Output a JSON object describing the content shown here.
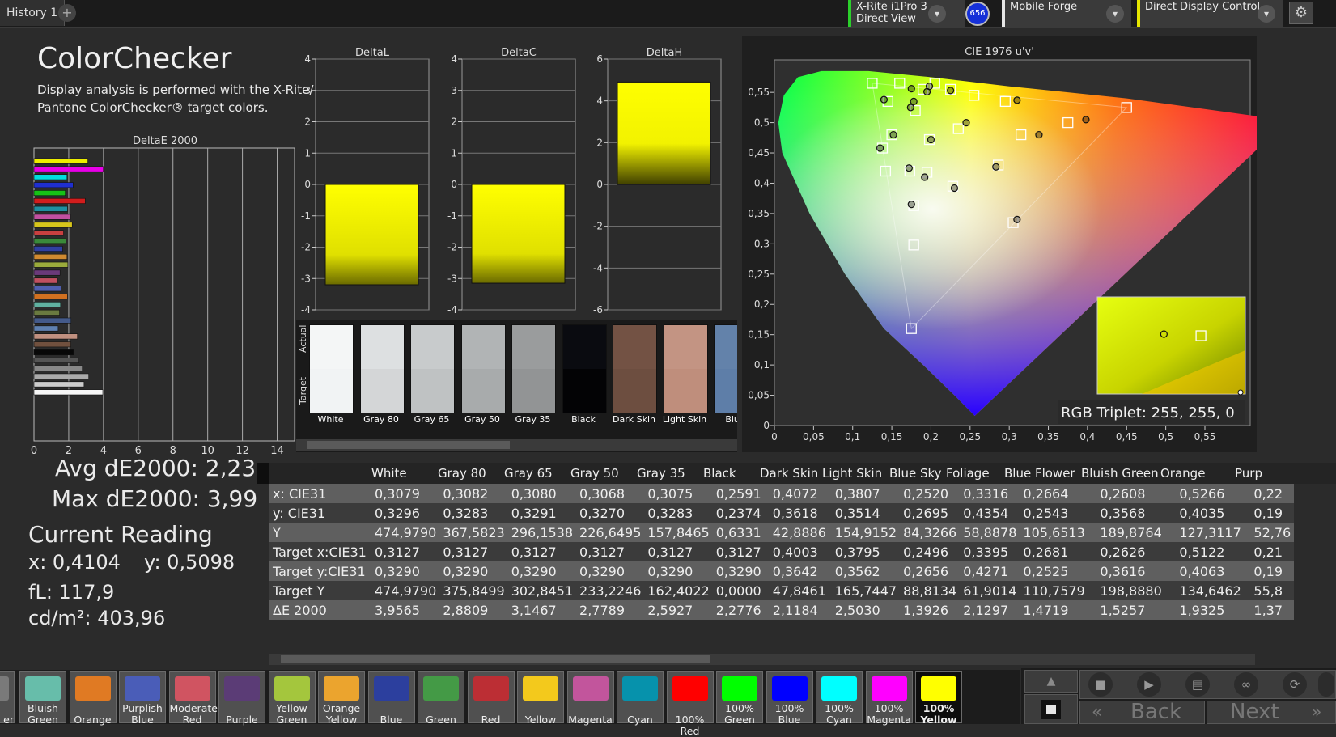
{
  "topbar": {
    "tab": "History 1",
    "add_tab": "+",
    "device": {
      "line1": "X-Rite i1Pro 3",
      "line2": "Direct View"
    },
    "device_badge": "656",
    "profile": "Mobile Forge",
    "mode": "Direct Display Control",
    "settings_icon": "gear-icon"
  },
  "page": {
    "title": "ColorChecker",
    "desc1": "Display analysis is performed with the X-Rite/",
    "desc2": "Pantone ColorChecker® target colors."
  },
  "deltae_chart": {
    "title": "DeltaE 2000",
    "xticks": [
      "0",
      "2",
      "4",
      "6",
      "8",
      "10",
      "12",
      "14"
    ],
    "xlim": [
      0,
      15
    ],
    "bars": [
      {
        "color": "#eded00",
        "value": 3.1
      },
      {
        "color": "#e800e8",
        "value": 3.99
      },
      {
        "color": "#00dede",
        "value": 1.9
      },
      {
        "color": "#1f2fd0",
        "value": 2.25
      },
      {
        "color": "#16c216",
        "value": 1.8
      },
      {
        "color": "#d21d1d",
        "value": 2.95
      },
      {
        "color": "#1f8fa0",
        "value": 1.93
      },
      {
        "color": "#c050a0",
        "value": 2.1
      },
      {
        "color": "#d6c51c",
        "value": 2.2
      },
      {
        "color": "#c84040",
        "value": 1.7
      },
      {
        "color": "#3a8a3a",
        "value": 1.85
      },
      {
        "color": "#3040a0",
        "value": 1.65
      },
      {
        "color": "#d08a30",
        "value": 1.9
      },
      {
        "color": "#9aaa3c",
        "value": 1.95
      },
      {
        "color": "#6a3a7a",
        "value": 1.5
      },
      {
        "color": "#c05060",
        "value": 1.35
      },
      {
        "color": "#5060b0",
        "value": 1.55
      },
      {
        "color": "#d07020",
        "value": 1.93
      },
      {
        "color": "#60b0a0",
        "value": 1.53
      },
      {
        "color": "#6a7a40",
        "value": 1.47
      },
      {
        "color": "#445a8a",
        "value": 2.13
      },
      {
        "color": "#5f80b0",
        "value": 1.39
      },
      {
        "color": "#c09080",
        "value": 2.5
      },
      {
        "color": "#70503e",
        "value": 2.12
      },
      {
        "color": "#080808",
        "value": 2.28
      },
      {
        "color": "#555555",
        "value": 2.59
      },
      {
        "color": "#888888",
        "value": 2.78
      },
      {
        "color": "#aaaaaa",
        "value": 3.15
      },
      {
        "color": "#cccccc",
        "value": 2.88
      },
      {
        "color": "#f6f6f6",
        "value": 3.96
      }
    ]
  },
  "delta_charts": [
    {
      "title": "DeltaL",
      "ylim": [
        -4,
        4
      ],
      "yticks": [
        "4",
        "3",
        "2",
        "1",
        "0",
        "-1",
        "-2",
        "-3",
        "-4"
      ],
      "value": -3.2
    },
    {
      "title": "DeltaC",
      "ylim": [
        -4,
        4
      ],
      "yticks": [
        "4",
        "3",
        "2",
        "1",
        "0",
        "-1",
        "-2",
        "-3",
        "-4"
      ],
      "value": -3.15
    },
    {
      "title": "DeltaH",
      "ylim": [
        -6,
        6
      ],
      "yticks": [
        "6",
        "4",
        "2",
        "0",
        "-2",
        "-4",
        "-6"
      ],
      "value": 4.9
    }
  ],
  "patch_strip": {
    "actual_label": "Actual",
    "target_label": "Target",
    "patches": [
      {
        "label": "White",
        "actual": "#f4f6f6",
        "target": "#f1f3f4"
      },
      {
        "label": "Gray 80",
        "actual": "#dde0e1",
        "target": "#d4d6d7"
      },
      {
        "label": "Gray 65",
        "actual": "#c8cbcc",
        "target": "#bfc2c3"
      },
      {
        "label": "Gray 50",
        "actual": "#b1b4b5",
        "target": "#a8abac"
      },
      {
        "label": "Gray 35",
        "actual": "#9a9c9d",
        "target": "#929495"
      },
      {
        "label": "Black",
        "actual": "#0a0b10",
        "target": "#030305"
      },
      {
        "label": "Dark Skin",
        "actual": "#735244",
        "target": "#6d4e40"
      },
      {
        "label": "Light Skin",
        "actual": "#c39483",
        "target": "#bf8e7c"
      },
      {
        "label": "Blue",
        "actual": "#6382aa",
        "target": "#5e7ea8"
      }
    ]
  },
  "cie_chart": {
    "title": "CIE 1976 u'v'",
    "xticks": [
      "0",
      "0,05",
      "0,1",
      "0,15",
      "0,2",
      "0,25",
      "0,3",
      "0,35",
      "0,4",
      "0,45",
      "0,5",
      "0,55"
    ],
    "yticks": [
      "0",
      "0,05",
      "0,1",
      "0,15",
      "0,2",
      "0,25",
      "0,3",
      "0,35",
      "0,4",
      "0,45",
      "0,5",
      "0,55"
    ],
    "xlim": [
      0,
      0.6
    ],
    "ylim": [
      0,
      0.6
    ],
    "targets": [
      [
        0.125,
        0.565
      ],
      [
        0.145,
        0.535
      ],
      [
        0.16,
        0.565
      ],
      [
        0.18,
        0.52
      ],
      [
        0.19,
        0.555
      ],
      [
        0.205,
        0.565
      ],
      [
        0.225,
        0.555
      ],
      [
        0.255,
        0.545
      ],
      [
        0.295,
        0.535
      ],
      [
        0.235,
        0.49
      ],
      [
        0.315,
        0.48
      ],
      [
        0.375,
        0.5
      ],
      [
        0.45,
        0.525
      ],
      [
        0.15,
        0.48
      ],
      [
        0.198,
        0.472
      ],
      [
        0.138,
        0.458
      ],
      [
        0.142,
        0.42
      ],
      [
        0.173,
        0.42
      ],
      [
        0.195,
        0.418
      ],
      [
        0.228,
        0.395
      ],
      [
        0.286,
        0.43
      ],
      [
        0.305,
        0.335
      ],
      [
        0.178,
        0.363
      ],
      [
        0.178,
        0.298
      ],
      [
        0.175,
        0.16
      ]
    ],
    "measured": [
      [
        0.14,
        0.538
      ],
      [
        0.175,
        0.556
      ],
      [
        0.198,
        0.56
      ],
      [
        0.195,
        0.551
      ],
      [
        0.225,
        0.553
      ],
      [
        0.31,
        0.537
      ],
      [
        0.245,
        0.5
      ],
      [
        0.338,
        0.48
      ],
      [
        0.398,
        0.505
      ],
      [
        0.174,
        0.525
      ],
      [
        0.152,
        0.48
      ],
      [
        0.2,
        0.472
      ],
      [
        0.135,
        0.458
      ],
      [
        0.172,
        0.425
      ],
      [
        0.192,
        0.41
      ],
      [
        0.23,
        0.392
      ],
      [
        0.283,
        0.427
      ],
      [
        0.31,
        0.34
      ],
      [
        0.175,
        0.365
      ],
      [
        0.178,
        0.535
      ]
    ],
    "inset": {
      "target": [
        0.7,
        0.7
      ],
      "measured": [
        0.45,
        0.55
      ]
    },
    "rgb_triplet": "RGB Triplet: 255, 255, 0"
  },
  "stats": {
    "avg": "Avg dE2000: 2,23",
    "max": "Max dE2000: 3,99",
    "reading_title": "Current Reading",
    "x": "x: 0,4104",
    "y": "y: 0,5098",
    "fl": "fL: 117,9",
    "cdm2": "cd/m²: 403,96"
  },
  "table": {
    "columns": [
      "",
      "White",
      "Gray 80",
      "Gray 65",
      "Gray 50",
      "Gray 35",
      "Black",
      "Dark Skin",
      "Light Skin",
      "Blue Sky",
      "Foliage",
      "Blue Flower",
      "Bluish Green",
      "Orange",
      "Purp"
    ],
    "rows": [
      [
        "x: CIE31",
        "0,3079",
        "0,3082",
        "0,3080",
        "0,3068",
        "0,3075",
        "0,2591",
        "0,4072",
        "0,3807",
        "0,2520",
        "0,3316",
        "0,2664",
        "0,2608",
        "0,5266",
        "0,22"
      ],
      [
        "y: CIE31",
        "0,3296",
        "0,3283",
        "0,3291",
        "0,3270",
        "0,3283",
        "0,2374",
        "0,3618",
        "0,3514",
        "0,2695",
        "0,4354",
        "0,2543",
        "0,3568",
        "0,4035",
        "0,19"
      ],
      [
        "Y",
        "474,9790",
        "367,5823",
        "296,1538",
        "226,6495",
        "157,8465",
        "0,6331",
        "42,8886",
        "154,9152",
        "84,3266",
        "58,8878",
        "105,6513",
        "189,8764",
        "127,3117",
        "52,76"
      ],
      [
        "Target x:CIE31",
        "0,3127",
        "0,3127",
        "0,3127",
        "0,3127",
        "0,3127",
        "0,3127",
        "0,4003",
        "0,3795",
        "0,2496",
        "0,3395",
        "0,2681",
        "0,2626",
        "0,5122",
        "0,21"
      ],
      [
        "Target y:CIE31",
        "0,3290",
        "0,3290",
        "0,3290",
        "0,3290",
        "0,3290",
        "0,3290",
        "0,3642",
        "0,3562",
        "0,2656",
        "0,4271",
        "0,2525",
        "0,3616",
        "0,4063",
        "0,19"
      ],
      [
        "Target Y",
        "474,9790",
        "375,8499",
        "302,8451",
        "233,2246",
        "162,4022",
        "0,0000",
        "47,8461",
        "165,7447",
        "88,8134",
        "61,9014",
        "110,7579",
        "198,8880",
        "134,6462",
        "55,8"
      ],
      [
        "ΔE 2000",
        "3,9565",
        "2,8809",
        "3,1467",
        "2,7789",
        "2,5927",
        "2,2776",
        "2,1184",
        "2,5030",
        "1,3926",
        "2,1297",
        "1,4719",
        "1,5257",
        "1,9325",
        "1,37"
      ]
    ]
  },
  "swatches": [
    {
      "line1": "",
      "line2": "er",
      "color": ""
    },
    {
      "line1": "Bluish",
      "line2": "Green",
      "color": "#67bdaa"
    },
    {
      "line1": "",
      "line2": "Orange",
      "color": "#e07a23"
    },
    {
      "line1": "Purplish",
      "line2": "Blue",
      "color": "#4a5db8"
    },
    {
      "line1": "Moderate",
      "line2": "Red",
      "color": "#d05461"
    },
    {
      "line1": "",
      "line2": "Purple",
      "color": "#5b3c76"
    },
    {
      "line1": "Yellow",
      "line2": "Green",
      "color": "#a4c63d"
    },
    {
      "line1": "Orange",
      "line2": "Yellow",
      "color": "#eba42e"
    },
    {
      "line1": "",
      "line2": "Blue",
      "color": "#2c3f9e"
    },
    {
      "line1": "",
      "line2": "Green",
      "color": "#449a46"
    },
    {
      "line1": "",
      "line2": "Red",
      "color": "#bc2e34"
    },
    {
      "line1": "",
      "line2": "Yellow",
      "color": "#f3c91c"
    },
    {
      "line1": "",
      "line2": "Magenta",
      "color": "#c2559c"
    },
    {
      "line1": "",
      "line2": "Cyan",
      "color": "#0692ac"
    },
    {
      "line1": "",
      "line2": "100% Red",
      "color": "#ff0000"
    },
    {
      "line1": "100%",
      "line2": "Green",
      "color": "#00ff00"
    },
    {
      "line1": "100%",
      "line2": "Blue",
      "color": "#0000ff"
    },
    {
      "line1": "100%",
      "line2": "Cyan",
      "color": "#00ffff"
    },
    {
      "line1": "100%",
      "line2": "Magenta",
      "color": "#ff00ff"
    },
    {
      "line1": "100%",
      "line2": "Yellow",
      "color": "#ffff00"
    }
  ],
  "nav": {
    "back": "Back",
    "next": "Next"
  }
}
